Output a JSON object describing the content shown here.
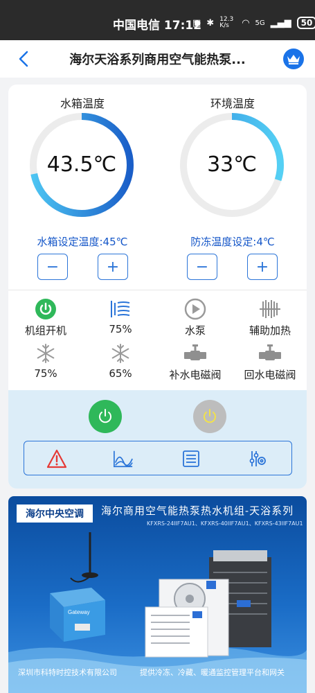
{
  "status_bar": {
    "carrier_time": "中国电信 17:12",
    "net_speed": "12.3 K/s",
    "signal": "5G",
    "battery": "50"
  },
  "header": {
    "title": "海尔天浴系列商用空气能热泵..."
  },
  "gauges": [
    {
      "title": "水箱温度",
      "value": "43.5℃",
      "fill_fraction": 0.72
    },
    {
      "title": "环境温度",
      "value": "33℃",
      "fill_fraction": 0.3
    }
  ],
  "settings": {
    "tank_set": "水箱设定温度:45℃",
    "antifreeze_set": "防冻温度设定:4℃",
    "minus": "−",
    "plus": "+"
  },
  "status_items": [
    {
      "label": "机组开机",
      "icon": "power-on-icon"
    },
    {
      "label": "75%",
      "icon": "fan-bars-icon"
    },
    {
      "label": "水泵",
      "icon": "pump-play-icon"
    },
    {
      "label": "辅助加热",
      "icon": "heater-icon"
    },
    {
      "label": "75%",
      "icon": "snowflake-icon"
    },
    {
      "label": "65%",
      "icon": "snowflake-icon"
    },
    {
      "label": "补水电磁阀",
      "icon": "valve-icon"
    },
    {
      "label": "回水电磁阀",
      "icon": "valve-icon"
    }
  ],
  "colors": {
    "accent_blue": "#2a74d8",
    "power_green": "#2fb85a",
    "power_grey": "#bdbdbd",
    "alert_red": "#e53935"
  },
  "banner": {
    "logo": "海尔中央空调",
    "title": "海尔商用空气能热泵热水机组-天浴系列",
    "models": "KFXRS-24IIF7AU1、KFXRS-40IIF7AU1、KFXRS-43IIF7AU1",
    "footer_left": "深圳市科特时控技术有限公司",
    "footer_right": "提供冷冻、冷藏、暖通监控管理平台和网关"
  }
}
